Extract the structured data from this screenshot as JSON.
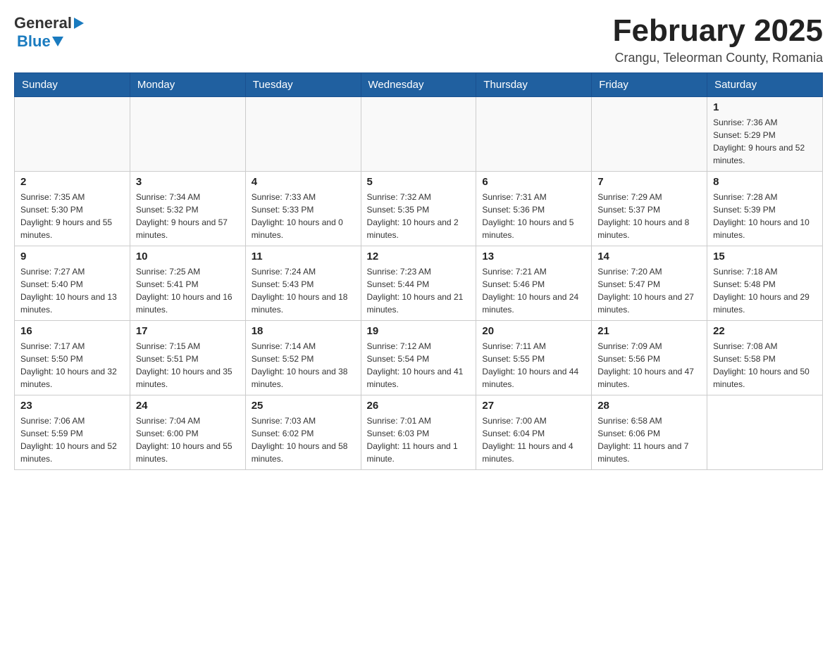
{
  "header": {
    "month_title": "February 2025",
    "location": "Crangu, Teleorman County, Romania",
    "logo_general": "General",
    "logo_blue": "Blue"
  },
  "weekdays": [
    "Sunday",
    "Monday",
    "Tuesday",
    "Wednesday",
    "Thursday",
    "Friday",
    "Saturday"
  ],
  "weeks": [
    [
      {
        "day": "",
        "sunrise": "",
        "sunset": "",
        "daylight": ""
      },
      {
        "day": "",
        "sunrise": "",
        "sunset": "",
        "daylight": ""
      },
      {
        "day": "",
        "sunrise": "",
        "sunset": "",
        "daylight": ""
      },
      {
        "day": "",
        "sunrise": "",
        "sunset": "",
        "daylight": ""
      },
      {
        "day": "",
        "sunrise": "",
        "sunset": "",
        "daylight": ""
      },
      {
        "day": "",
        "sunrise": "",
        "sunset": "",
        "daylight": ""
      },
      {
        "day": "1",
        "sunrise": "Sunrise: 7:36 AM",
        "sunset": "Sunset: 5:29 PM",
        "daylight": "Daylight: 9 hours and 52 minutes."
      }
    ],
    [
      {
        "day": "2",
        "sunrise": "Sunrise: 7:35 AM",
        "sunset": "Sunset: 5:30 PM",
        "daylight": "Daylight: 9 hours and 55 minutes."
      },
      {
        "day": "3",
        "sunrise": "Sunrise: 7:34 AM",
        "sunset": "Sunset: 5:32 PM",
        "daylight": "Daylight: 9 hours and 57 minutes."
      },
      {
        "day": "4",
        "sunrise": "Sunrise: 7:33 AM",
        "sunset": "Sunset: 5:33 PM",
        "daylight": "Daylight: 10 hours and 0 minutes."
      },
      {
        "day": "5",
        "sunrise": "Sunrise: 7:32 AM",
        "sunset": "Sunset: 5:35 PM",
        "daylight": "Daylight: 10 hours and 2 minutes."
      },
      {
        "day": "6",
        "sunrise": "Sunrise: 7:31 AM",
        "sunset": "Sunset: 5:36 PM",
        "daylight": "Daylight: 10 hours and 5 minutes."
      },
      {
        "day": "7",
        "sunrise": "Sunrise: 7:29 AM",
        "sunset": "Sunset: 5:37 PM",
        "daylight": "Daylight: 10 hours and 8 minutes."
      },
      {
        "day": "8",
        "sunrise": "Sunrise: 7:28 AM",
        "sunset": "Sunset: 5:39 PM",
        "daylight": "Daylight: 10 hours and 10 minutes."
      }
    ],
    [
      {
        "day": "9",
        "sunrise": "Sunrise: 7:27 AM",
        "sunset": "Sunset: 5:40 PM",
        "daylight": "Daylight: 10 hours and 13 minutes."
      },
      {
        "day": "10",
        "sunrise": "Sunrise: 7:25 AM",
        "sunset": "Sunset: 5:41 PM",
        "daylight": "Daylight: 10 hours and 16 minutes."
      },
      {
        "day": "11",
        "sunrise": "Sunrise: 7:24 AM",
        "sunset": "Sunset: 5:43 PM",
        "daylight": "Daylight: 10 hours and 18 minutes."
      },
      {
        "day": "12",
        "sunrise": "Sunrise: 7:23 AM",
        "sunset": "Sunset: 5:44 PM",
        "daylight": "Daylight: 10 hours and 21 minutes."
      },
      {
        "day": "13",
        "sunrise": "Sunrise: 7:21 AM",
        "sunset": "Sunset: 5:46 PM",
        "daylight": "Daylight: 10 hours and 24 minutes."
      },
      {
        "day": "14",
        "sunrise": "Sunrise: 7:20 AM",
        "sunset": "Sunset: 5:47 PM",
        "daylight": "Daylight: 10 hours and 27 minutes."
      },
      {
        "day": "15",
        "sunrise": "Sunrise: 7:18 AM",
        "sunset": "Sunset: 5:48 PM",
        "daylight": "Daylight: 10 hours and 29 minutes."
      }
    ],
    [
      {
        "day": "16",
        "sunrise": "Sunrise: 7:17 AM",
        "sunset": "Sunset: 5:50 PM",
        "daylight": "Daylight: 10 hours and 32 minutes."
      },
      {
        "day": "17",
        "sunrise": "Sunrise: 7:15 AM",
        "sunset": "Sunset: 5:51 PM",
        "daylight": "Daylight: 10 hours and 35 minutes."
      },
      {
        "day": "18",
        "sunrise": "Sunrise: 7:14 AM",
        "sunset": "Sunset: 5:52 PM",
        "daylight": "Daylight: 10 hours and 38 minutes."
      },
      {
        "day": "19",
        "sunrise": "Sunrise: 7:12 AM",
        "sunset": "Sunset: 5:54 PM",
        "daylight": "Daylight: 10 hours and 41 minutes."
      },
      {
        "day": "20",
        "sunrise": "Sunrise: 7:11 AM",
        "sunset": "Sunset: 5:55 PM",
        "daylight": "Daylight: 10 hours and 44 minutes."
      },
      {
        "day": "21",
        "sunrise": "Sunrise: 7:09 AM",
        "sunset": "Sunset: 5:56 PM",
        "daylight": "Daylight: 10 hours and 47 minutes."
      },
      {
        "day": "22",
        "sunrise": "Sunrise: 7:08 AM",
        "sunset": "Sunset: 5:58 PM",
        "daylight": "Daylight: 10 hours and 50 minutes."
      }
    ],
    [
      {
        "day": "23",
        "sunrise": "Sunrise: 7:06 AM",
        "sunset": "Sunset: 5:59 PM",
        "daylight": "Daylight: 10 hours and 52 minutes."
      },
      {
        "day": "24",
        "sunrise": "Sunrise: 7:04 AM",
        "sunset": "Sunset: 6:00 PM",
        "daylight": "Daylight: 10 hours and 55 minutes."
      },
      {
        "day": "25",
        "sunrise": "Sunrise: 7:03 AM",
        "sunset": "Sunset: 6:02 PM",
        "daylight": "Daylight: 10 hours and 58 minutes."
      },
      {
        "day": "26",
        "sunrise": "Sunrise: 7:01 AM",
        "sunset": "Sunset: 6:03 PM",
        "daylight": "Daylight: 11 hours and 1 minute."
      },
      {
        "day": "27",
        "sunrise": "Sunrise: 7:00 AM",
        "sunset": "Sunset: 6:04 PM",
        "daylight": "Daylight: 11 hours and 4 minutes."
      },
      {
        "day": "28",
        "sunrise": "Sunrise: 6:58 AM",
        "sunset": "Sunset: 6:06 PM",
        "daylight": "Daylight: 11 hours and 7 minutes."
      },
      {
        "day": "",
        "sunrise": "",
        "sunset": "",
        "daylight": ""
      }
    ]
  ]
}
